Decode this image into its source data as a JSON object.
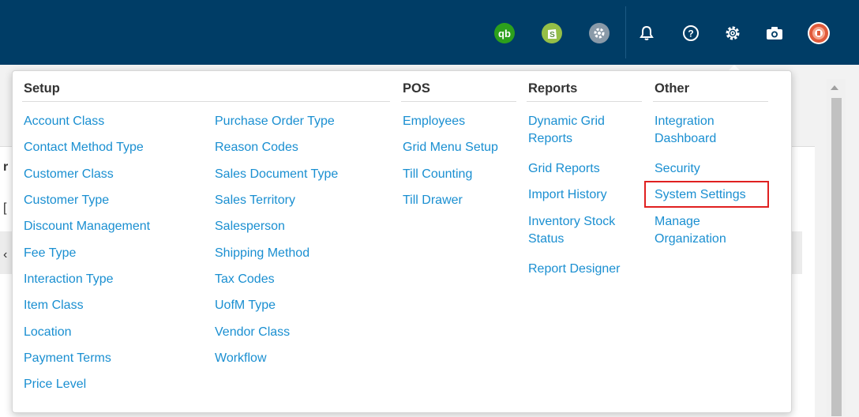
{
  "topbar": {
    "icons": [
      {
        "name": "quickbooks-icon",
        "color": "#2ca01c",
        "glyph": "qb"
      },
      {
        "name": "shopify-icon",
        "color": "#95bf47",
        "glyph": "S"
      },
      {
        "name": "plugin-gear-icon",
        "color": "#8a9aa8",
        "glyph": "⚙"
      },
      {
        "name": "bell-icon",
        "glyph": "bell"
      },
      {
        "name": "help-icon",
        "glyph": "?"
      },
      {
        "name": "settings-gear-icon",
        "glyph": "gear"
      },
      {
        "name": "camera-icon",
        "glyph": "camera"
      },
      {
        "name": "user-avatar",
        "color": "#e05a3a"
      }
    ]
  },
  "menu": {
    "setup": {
      "title": "Setup",
      "col1": [
        "Account Class",
        "Contact Method Type",
        "Customer Class",
        "Customer Type",
        "Discount Management",
        "Fee Type",
        "Interaction Type",
        "Item Class",
        "Location",
        "Payment Terms",
        "Price Level"
      ],
      "col2": [
        "Purchase Order Type",
        "Reason Codes",
        "Sales Document Type",
        "Sales Territory",
        "Salesperson",
        "Shipping Method",
        "Tax Codes",
        "UofM Type",
        "Vendor Class",
        "Workflow"
      ]
    },
    "pos": {
      "title": "POS",
      "items": [
        "Employees",
        "Grid Menu Setup",
        "Till Counting",
        "Till Drawer"
      ]
    },
    "reports": {
      "title": "Reports",
      "items": [
        "Dynamic Grid Reports",
        "Grid Reports",
        "Import History",
        "Inventory Stock Status",
        "Report Designer"
      ]
    },
    "other": {
      "title": "Other",
      "items": [
        "Integration Dashboard",
        "Security",
        "System Settings",
        "Manage Organization"
      ],
      "highlighted": "System Settings"
    }
  },
  "colors": {
    "topbar": "#003d66",
    "link": "#1a8fd1",
    "highlight_border": "#e02020"
  }
}
